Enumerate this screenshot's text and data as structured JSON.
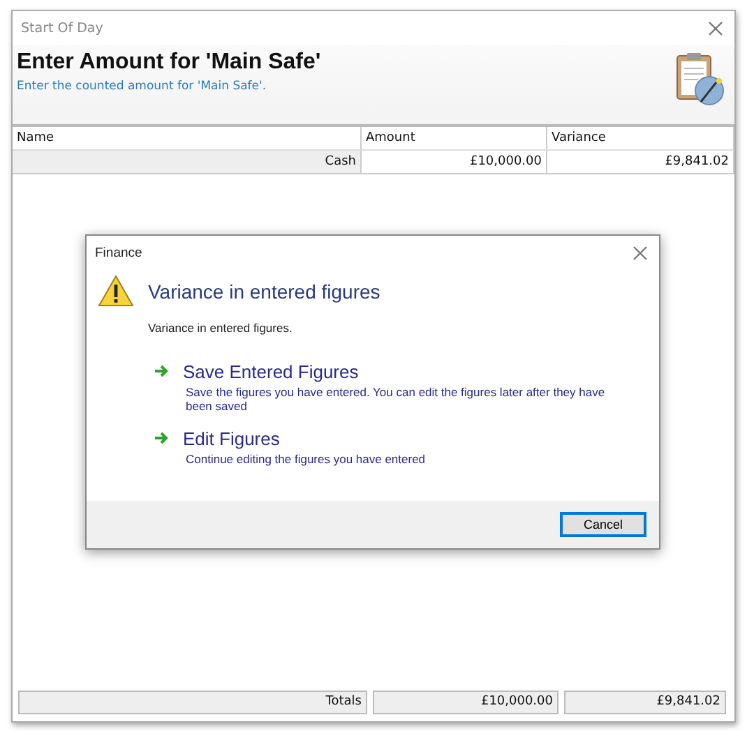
{
  "window": {
    "title": "Start Of Day",
    "heading": "Enter Amount for 'Main Safe'",
    "subtitle": "Enter the counted amount for 'Main Safe'."
  },
  "table": {
    "columns": [
      "Name",
      "Amount",
      "Variance"
    ],
    "rows": [
      [
        "Cash",
        "£10,000.00",
        "£9,841.02"
      ]
    ],
    "totals": [
      "Totals",
      "£10,000.00",
      "£9,841.02"
    ]
  },
  "dialog": {
    "title": "Finance",
    "heading": "Variance in entered figures",
    "message": "Variance in entered figures.",
    "options": [
      {
        "title": "Save Entered Figures",
        "description": "Save the figures you have entered.  You can edit the figures later after they have been saved"
      },
      {
        "title": "Edit Figures",
        "description": "Continue editing the figures you have entered"
      }
    ],
    "buttons": [
      "Cancel"
    ]
  }
}
